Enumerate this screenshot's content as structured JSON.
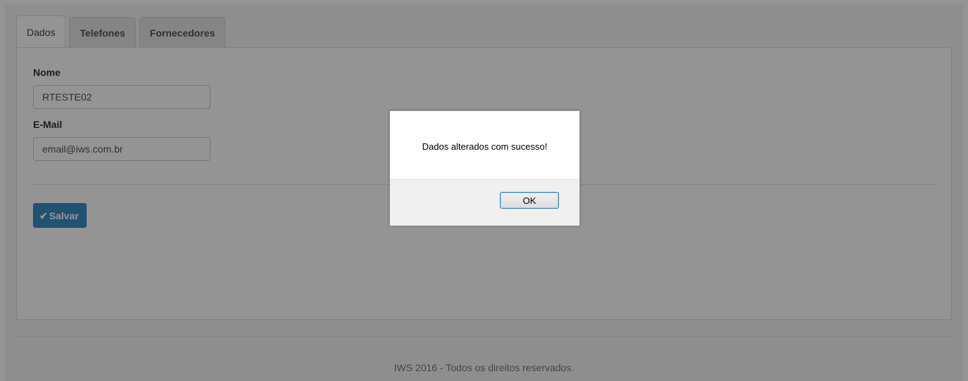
{
  "tabs": [
    {
      "label": "Dados",
      "active": true
    },
    {
      "label": "Telefones",
      "active": false
    },
    {
      "label": "Fornecedores",
      "active": false
    }
  ],
  "form": {
    "name_label": "Nome",
    "name_value": "RTESTE02",
    "email_label": "E-Mail",
    "email_value": "email@iws.com.br"
  },
  "save_button": {
    "icon": "check-icon",
    "label": "Salvar"
  },
  "footer": {
    "text": "IWS 2016 - Todos os direitos reservados."
  },
  "dialog": {
    "message": "Dados alterados com sucesso!",
    "ok_label": "OK"
  },
  "colors": {
    "primary_button": "#3b8dc5",
    "overlay": "rgba(0,0,0,0.42)"
  }
}
